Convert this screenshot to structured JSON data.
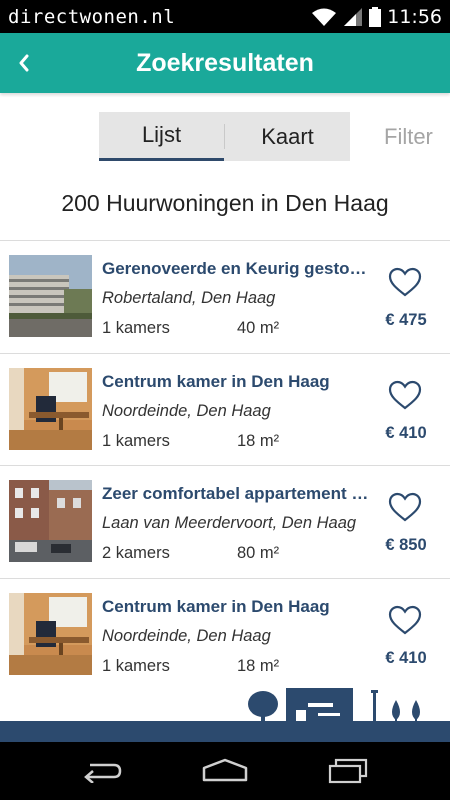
{
  "status_bar": {
    "brand": "directwonen.nl",
    "time": "11:56"
  },
  "app_bar": {
    "title": "Zoekresultaten"
  },
  "segments": {
    "list": "Lijst",
    "map": "Kaart"
  },
  "filter_label": "Filter",
  "result_count": "200 Huurwoningen in Den Haag",
  "listings": [
    {
      "title": "Gerenoveerde en Keurig gestoffeerd",
      "location": "Robertaland, Den Haag",
      "rooms": "1 kamers",
      "area": "40 m²",
      "price": "€ 475",
      "image": "apartment-building-exterior"
    },
    {
      "title": "Centrum kamer in Den Haag",
      "location": "Noordeinde, Den Haag",
      "rooms": "1 kamers",
      "area": "18 m²",
      "price": "€ 410",
      "image": "room-interior-desk"
    },
    {
      "title": "Zeer comfortabel appartement op",
      "location": "Laan van Meerdervoort, Den Haag",
      "rooms": "2 kamers",
      "area": "80 m²",
      "price": "€ 850",
      "image": "street-view-buildings"
    },
    {
      "title": " Centrum kamer in Den Haag",
      "location": "Noordeinde, Den Haag",
      "rooms": "1 kamers",
      "area": "18 m²",
      "price": "€ 410",
      "image": "room-interior-desk"
    }
  ],
  "colors": {
    "primary": "#1aa99a",
    "navy": "#2c4a6e",
    "segment_bg": "#e5e5e5"
  }
}
